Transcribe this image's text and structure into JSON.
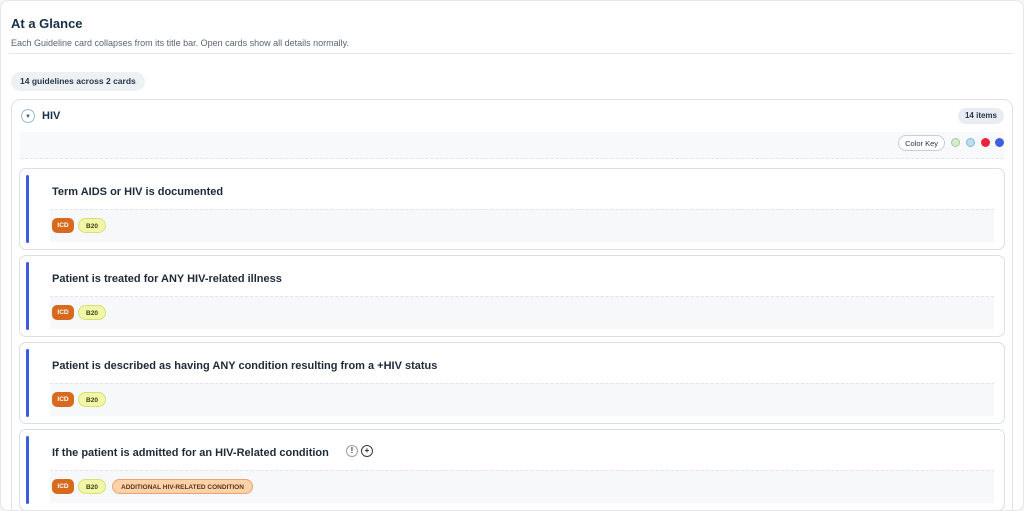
{
  "header": {
    "title": "At a Glance",
    "subtitle": "Each Guideline card collapses from its title bar. Open cards show all details normally."
  },
  "summary": "14 guidelines across 2 cards",
  "group": {
    "toggle_icon": "▼",
    "name": "HIV",
    "count": "14 items",
    "color_key_label": "Color Key",
    "legend_colors": [
      "#d3eecb",
      "#b9ddf2",
      "#e8243c",
      "#3f5fdc"
    ]
  },
  "cards": [
    {
      "title": "Term AIDS or HIV is documented",
      "tags": [
        "ICD",
        "B20"
      ]
    },
    {
      "title": "Patient is treated for ANY HIV-related illness",
      "tags": [
        "ICD",
        "B20"
      ]
    },
    {
      "title": "Patient is described as having ANY condition resulting from a +HIV status",
      "tags": [
        "ICD",
        "B20"
      ]
    },
    {
      "title": "If the patient is admitted for an HIV-Related condition",
      "tags": [
        "ICD",
        "B20",
        "ADDITIONAL HIV-RELATED CONDITION"
      ],
      "icons": [
        "info-icon",
        "add-icon"
      ],
      "icon_glyphs": [
        "!",
        "+"
      ]
    }
  ],
  "accent_color": "#3d5ce0"
}
